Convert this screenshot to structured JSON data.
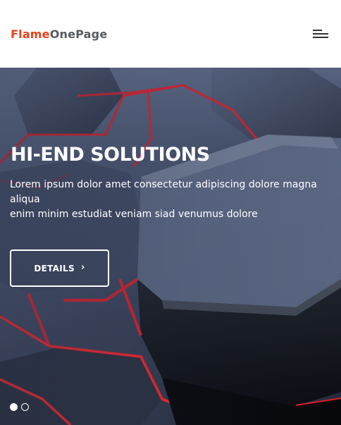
{
  "header": {
    "logo_part1": "Flame",
    "logo_part2": "OnePage",
    "menu_icon": "hamburger-menu-icon"
  },
  "hero": {
    "title": "HI-END SOLUTIONS",
    "text_line1": "Lorem ipsum dolor amet consectetur adipiscing dolore magna aliqua",
    "text_line2": "enim minim estudiat veniam siad venumus dolore",
    "button_label": "DETAILS",
    "button_icon": "chevron-right-icon",
    "slides": {
      "count": 2,
      "active": 1
    }
  },
  "colors": {
    "logo_accent": "#e8421c",
    "logo_dark": "#555a60",
    "hero_text": "#ffffff",
    "glow_lines": "#e0202a"
  }
}
